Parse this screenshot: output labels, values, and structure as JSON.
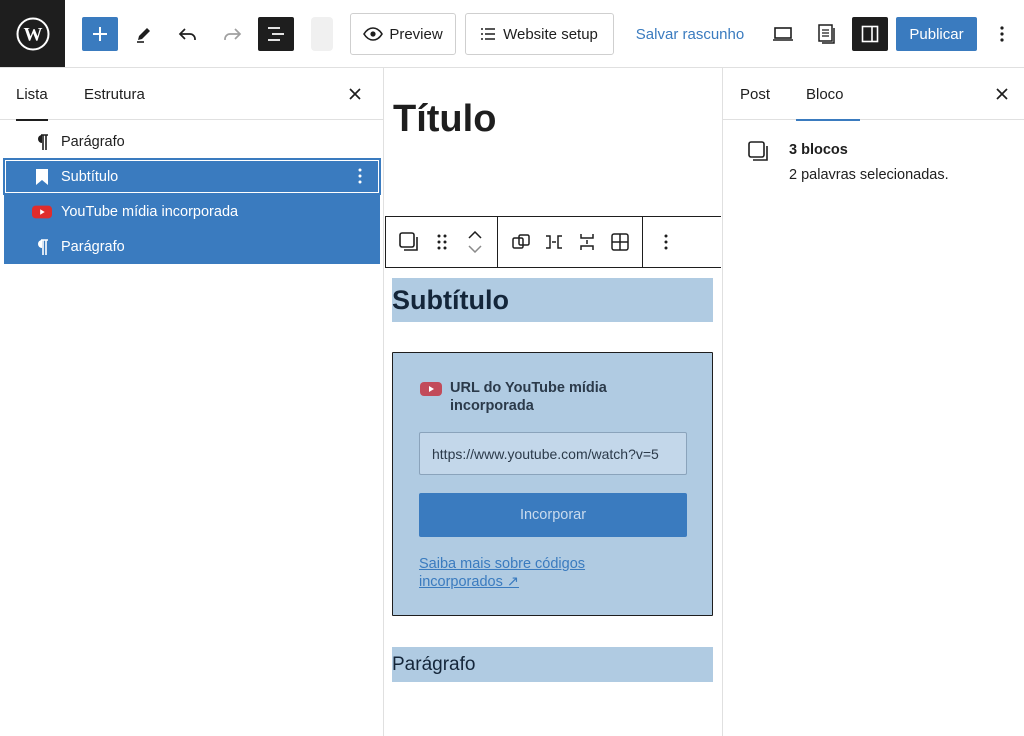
{
  "toolbar": {
    "preview_label": "Preview",
    "setup_label": "Website setup",
    "save_draft_label": "Salvar rascunho",
    "publish_label": "Publicar"
  },
  "left_panel": {
    "tabs": [
      {
        "label": "Lista",
        "active": true
      },
      {
        "label": "Estrutura",
        "active": false
      }
    ],
    "items": [
      {
        "label": "Parágrafo",
        "icon": "paragraph-icon",
        "selected": false
      },
      {
        "label": "Subtítulo",
        "icon": "bookmark-icon",
        "selected": true
      },
      {
        "label": "YouTube mídia incorporada",
        "icon": "youtube-icon",
        "selected": true
      },
      {
        "label": "Parágrafo",
        "icon": "paragraph-icon",
        "selected": true
      }
    ]
  },
  "canvas": {
    "title": "Título",
    "subtitle": "Subtítulo",
    "embed": {
      "label": "URL do YouTube mídia incorporada",
      "input_value": "https://www.youtube.com/watch?v=5",
      "button_label": "Incorporar",
      "link_text": "Saiba mais sobre códigos incorporados ↗"
    },
    "paragraph": "Parágrafo"
  },
  "right_panel": {
    "tabs": [
      {
        "label": "Post",
        "active": false
      },
      {
        "label": "Bloco",
        "active": true
      }
    ],
    "block_count": "3 blocos",
    "word_count": "2 palavras selecionadas."
  },
  "colors": {
    "accent": "#3a7bbf",
    "selection": "#b0cbe2",
    "dark": "#1e1e1e",
    "youtube": "#e02c2c"
  }
}
